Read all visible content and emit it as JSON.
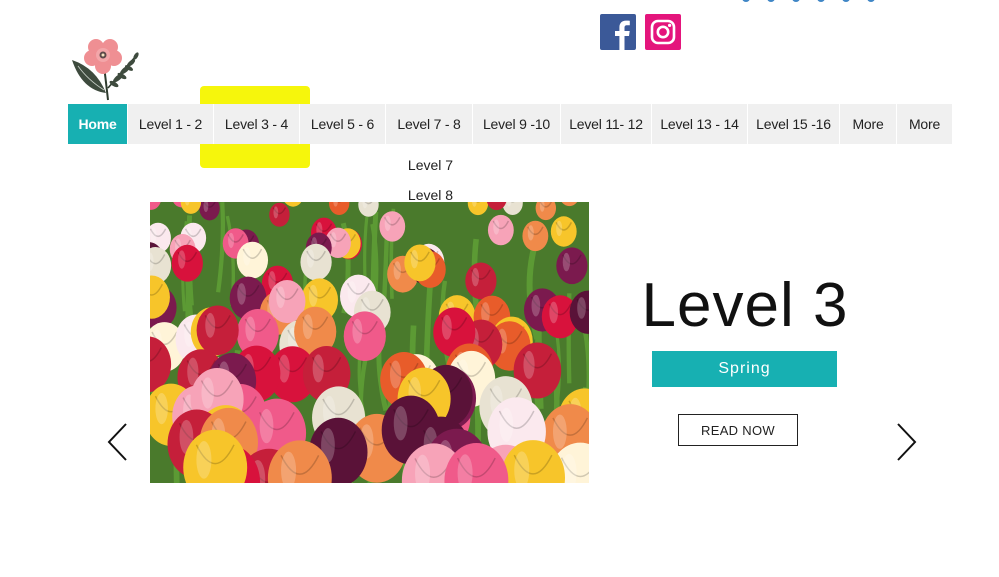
{
  "nav": {
    "items": [
      {
        "label": "Home",
        "active": true,
        "width": 60
      },
      {
        "label": "Level 1 - 2",
        "active": false,
        "width": 86
      },
      {
        "label": "Level 3 - 4",
        "active": false,
        "width": 86
      },
      {
        "label": "Level 5 - 6",
        "active": false,
        "width": 86
      },
      {
        "label": "Level 7 - 8",
        "active": false,
        "width": 87
      },
      {
        "label": "Level 9 -10",
        "active": false,
        "width": 88
      },
      {
        "label": "Level 11- 12",
        "active": false,
        "width": 91
      },
      {
        "label": "Level 13 - 14",
        "active": false,
        "width": 96
      },
      {
        "label": "Level 15 -16",
        "active": false,
        "width": 92
      },
      {
        "label": "More",
        "active": false,
        "width": 57
      },
      {
        "label": "More",
        "active": false,
        "width": 56
      }
    ],
    "dropdown": [
      "Level 7",
      "Level 8"
    ]
  },
  "hero": {
    "title": "Level 3",
    "tag": "Spring",
    "button": "READ NOW"
  },
  "colors": {
    "accent": "#17b0b2",
    "highlight": "#f6f604",
    "facebook": "#3b5998",
    "instagram": "#e4157c"
  },
  "icons": {
    "facebook": "facebook-icon",
    "instagram": "instagram-icon",
    "prev": "chevron-left-icon",
    "next": "chevron-right-icon"
  }
}
